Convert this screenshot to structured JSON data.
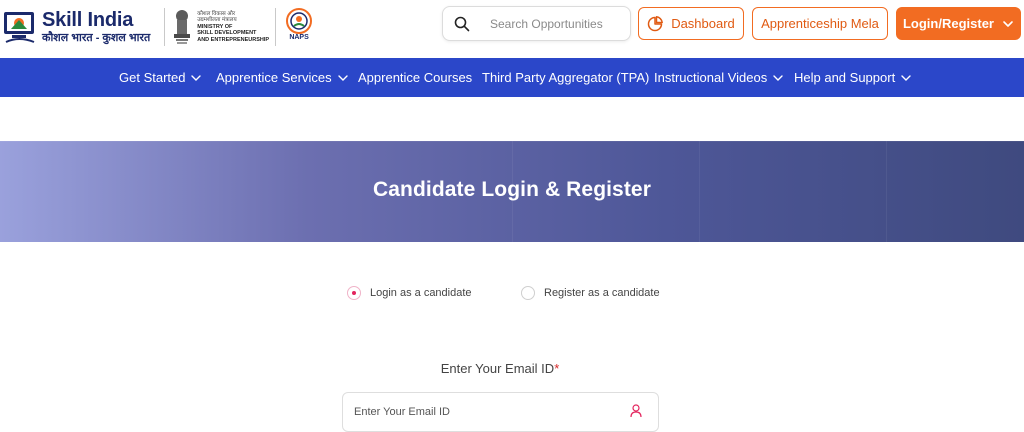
{
  "brand": {
    "title": "Skill India",
    "subtitle": "कौशल भारत - कुशल भारत",
    "ministry_hi_line1": "कौशल विकास और",
    "ministry_hi_line2": "उद्यमशीलता मंत्रालय",
    "ministry_en_line1": "MINISTRY OF",
    "ministry_en_line2": "SKILL DEVELOPMENT",
    "ministry_en_line3": "AND ENTREPRENEURSHIP",
    "naps_label": "NAPS",
    "accent_color": "#f26c22",
    "nav_color": "#2b47c9"
  },
  "search": {
    "placeholder": "Search Opportunities"
  },
  "header_buttons": {
    "dashboard": "Dashboard",
    "mela": "Apprenticeship Mela",
    "login": "Login/Register"
  },
  "nav": {
    "items": [
      {
        "label": "Get Started",
        "has_dropdown": true
      },
      {
        "label": "Apprentice Services",
        "has_dropdown": true
      },
      {
        "label": "Apprentice Courses",
        "has_dropdown": false
      },
      {
        "label": "Third Party Aggregator (TPA)",
        "has_dropdown": false
      },
      {
        "label": "Instructional Videos",
        "has_dropdown": true
      },
      {
        "label": "Help and Support",
        "has_dropdown": true
      }
    ]
  },
  "banner": {
    "title": "Candidate Login & Register"
  },
  "mode": {
    "options": [
      {
        "label": "Login as a candidate",
        "selected": true
      },
      {
        "label": "Register as a candidate",
        "selected": false
      }
    ]
  },
  "form": {
    "email_label": "Enter Your Email ID",
    "required_mark": "*",
    "email_placeholder": "Enter Your Email ID"
  }
}
